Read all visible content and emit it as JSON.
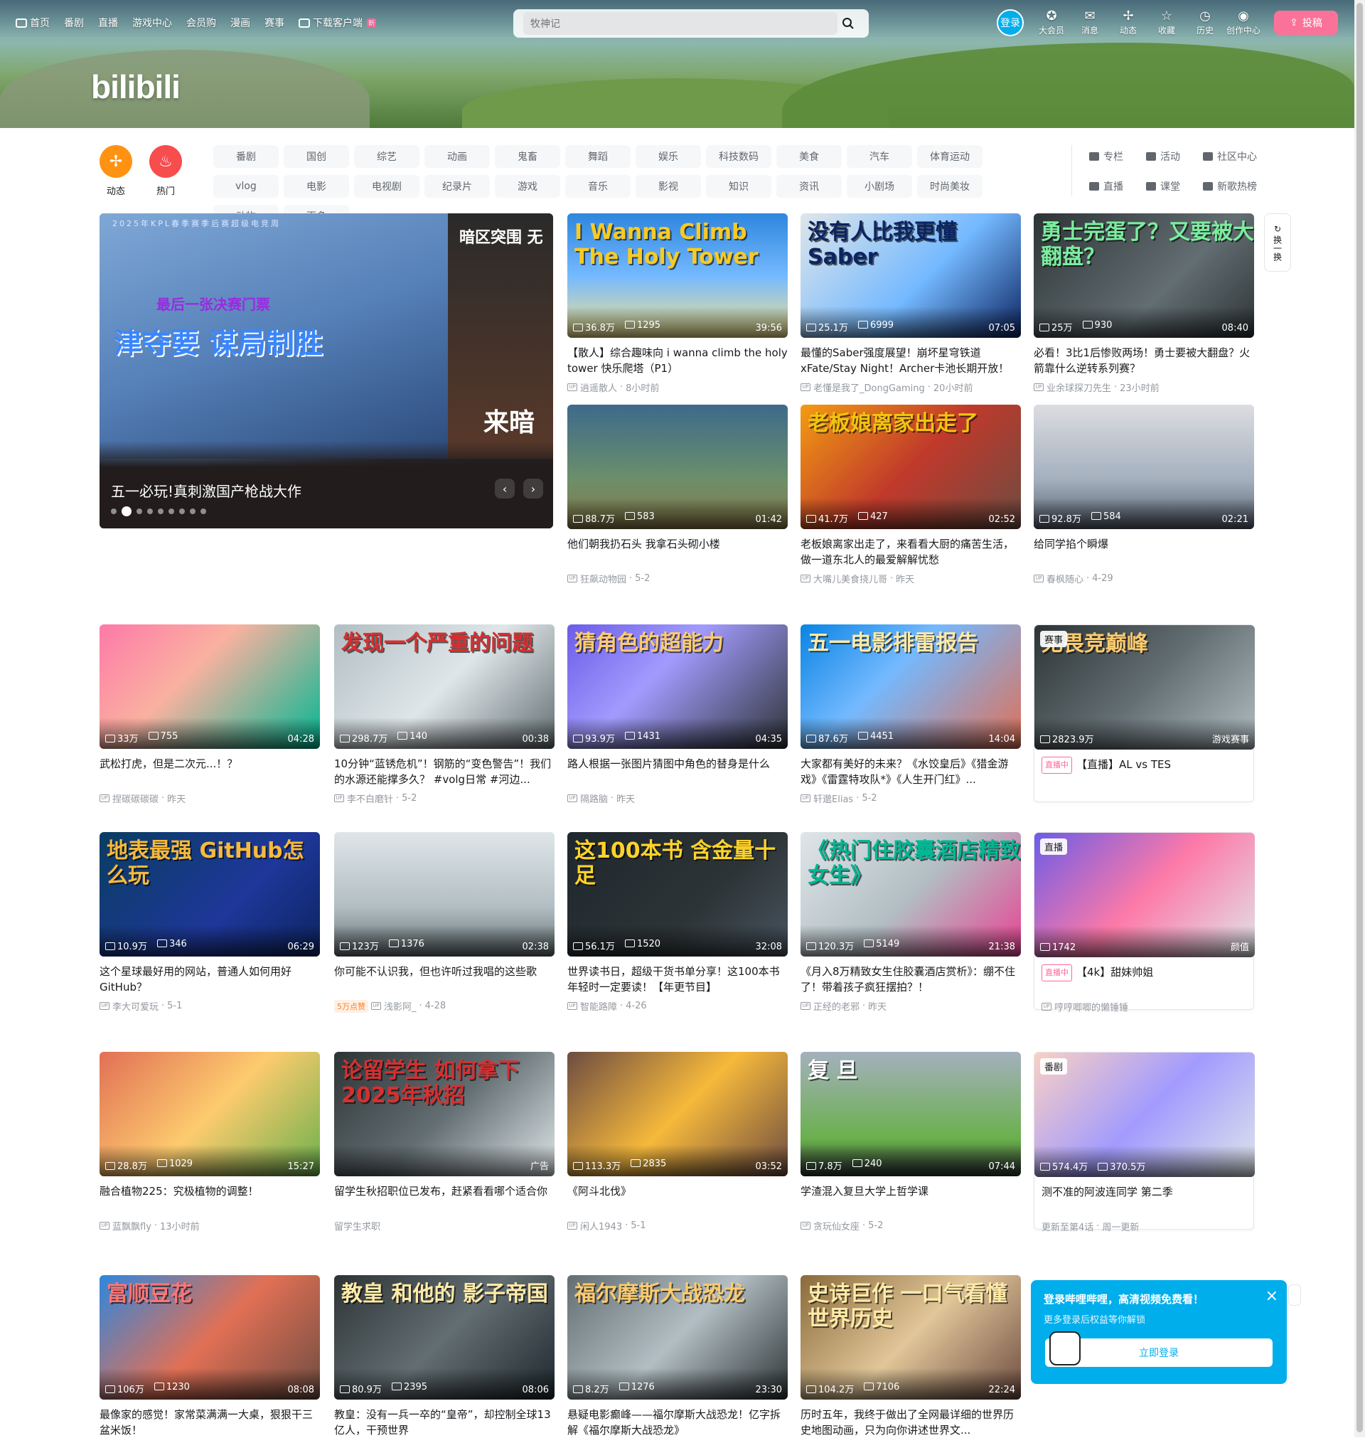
{
  "header": {
    "nav": [
      {
        "label": "首页"
      },
      {
        "label": "番剧"
      },
      {
        "label": "直播"
      },
      {
        "label": "游戏中心"
      },
      {
        "label": "会员购"
      },
      {
        "label": "漫画"
      },
      {
        "label": "赛事"
      },
      {
        "label": "下载客户端",
        "new": "新"
      }
    ],
    "search_placeholder": "牧神记",
    "login_label": "登录",
    "right_icons": [
      {
        "label": "大会员",
        "icon": "vip-icon"
      },
      {
        "label": "消息",
        "icon": "message-icon"
      },
      {
        "label": "动态",
        "icon": "dynamic-icon"
      },
      {
        "label": "收藏",
        "icon": "favorite-icon"
      },
      {
        "label": "历史",
        "icon": "history-icon"
      },
      {
        "label": "创作中心",
        "icon": "creator-icon"
      }
    ],
    "upload_label": "投稿",
    "logo": "bilibili"
  },
  "channels": {
    "dynamic_label": "动态",
    "hot_label": "热门",
    "items": [
      "番剧",
      "国创",
      "综艺",
      "动画",
      "鬼畜",
      "舞蹈",
      "娱乐",
      "科技数码",
      "美食",
      "汽车",
      "体育运动",
      "vlog",
      "电影",
      "电视剧",
      "纪录片",
      "游戏",
      "音乐",
      "影视",
      "知识",
      "资讯",
      "小剧场",
      "时尚美妆",
      "动物",
      "更多"
    ],
    "extra": [
      "专栏",
      "活动",
      "社区中心",
      "直播",
      "课堂",
      "新歌热榜"
    ]
  },
  "carousel": {
    "top_text": "2025年KPL春季赛季后赛超级电竞周",
    "sub_text": "最后一张决赛门票",
    "big_text": "津夺要 谋局制胜",
    "side_top": "暗区突围 无",
    "side_bottom": "来暗",
    "title": "五一必玩!真刺激国产枪战大作",
    "prev": "‹",
    "next": "›"
  },
  "swap_label": "换一换",
  "cards": [
    {
      "title": "【散人】综合趣味向 i wanna climb the holy tower 快乐爬塔（P1）",
      "views": "36.8万",
      "danmaku": "1295",
      "duration": "39:56",
      "author": "逍遥散人",
      "time": "8小时前",
      "overlay": "I Wanna Climb The Holy Tower",
      "bg": "linear-gradient(180deg,#2e86de,#74b9ff 50%,#f6e58d)",
      "ovc": "#f9ca24"
    },
    {
      "title": "最懂的Saber强度展望！崩坏星穹铁道xFate/Stay Night！Archer卡池长期开放！剖...",
      "views": "25.1万",
      "danmaku": "6999",
      "duration": "07:05",
      "author": "老懂是我了_DongGaming",
      "time": "20小时前",
      "overlay": "没有人比我更懂Saber",
      "bg": "linear-gradient(135deg,#dfe6e9,#74b9ff 55%,#0c2461)",
      "ovc": "#0c2461"
    },
    {
      "title": "必看！3比1后惨败两场！勇士要被大翻盘？火箭靠什么逆转系列赛？",
      "views": "25万",
      "danmaku": "930",
      "duration": "08:40",
      "author": "业余球探刀先生",
      "time": "23小时前",
      "overlay": "勇士完蛋了？又要被大翻盘？",
      "bg": "linear-gradient(135deg,#2d3436,#636e72 60%,#2d3436)",
      "ovc": "#7bed9f"
    },
    {
      "title": "他们朝我扔石头 我拿石头砌小楼",
      "views": "88.7万",
      "danmaku": "583",
      "duration": "01:42",
      "author": "狂飙动物园",
      "time": "5-2",
      "overlay": "",
      "bg": "linear-gradient(180deg,#3d6a8c,#6c8f6a 60%,#8a7a4a)",
      "ovc": "#fff"
    },
    {
      "title": "老板娘离家出走了，来看看大厨的痛苦生活，做一道东北人的最爱解解忧愁",
      "views": "41.7万",
      "danmaku": "427",
      "duration": "02:52",
      "author": "大嘴儿美食挠儿哥",
      "time": "昨天",
      "overlay": "老板娘离家出走了",
      "bg": "linear-gradient(135deg,#f39c12,#c0392b 50%,#6d4c41)",
      "ovc": "#f1c40f"
    },
    {
      "title": "给同学掐个瞬爆",
      "views": "92.8万",
      "danmaku": "584",
      "duration": "02:21",
      "author": "春枫随心",
      "time": "4-29",
      "overlay": "",
      "bg": "linear-gradient(180deg,#dcdde1,#a4b0be 60%,#57606f)",
      "ovc": "#fff"
    },
    {
      "title": "武松打虎，但是二次元...！？",
      "views": "33万",
      "danmaku": "755",
      "duration": "04:28",
      "author": "捏碳碳碳碳",
      "time": "昨天",
      "overlay": "",
      "bg": "linear-gradient(135deg,#fd79a8,#fab1a0 40%,#00b894)",
      "ovc": "#fff"
    },
    {
      "title": "10分钟“蓝锈危机”！钢筋的“变色警告”！我们的水源还能撑多久？ #volg日常 #河边...",
      "views": "298.7万",
      "danmaku": "140",
      "duration": "00:38",
      "author": "李不白磨针",
      "time": "5-2",
      "overlay": "发现一个严重的问题",
      "bg": "linear-gradient(135deg,#b2bec3,#dfe6e9 50%,#636e72)",
      "ovc": "#d63031"
    },
    {
      "title": "路人根据一张图片猜图中角色的替身是什么",
      "views": "93.9万",
      "danmaku": "1431",
      "duration": "04:35",
      "author": "隔路脑",
      "time": "昨天",
      "overlay": "猜角色的超能力",
      "bg": "linear-gradient(135deg,#6c5ce7,#a29bfe 40%,#2d3436)",
      "ovc": "#fdcb6e"
    },
    {
      "title": "大家都有美好的未来？《水饺皇后》《猎金游戏》《雷霆特攻队*》《人生开门红》...",
      "views": "87.6万",
      "danmaku": "4451",
      "duration": "14:04",
      "author": "轩邈Elias",
      "time": "5-2",
      "overlay": "五一电影排雷报告",
      "bg": "linear-gradient(135deg,#0984e3,#74b9ff 40%,#e17055)",
      "ovc": "#ffeaa7"
    },
    {
      "title": "【直播】AL vs TES",
      "views": "2823.9万",
      "danmaku": "",
      "duration": "游戏赛事",
      "author": "",
      "time": "",
      "overlay": "无畏竞巅峰",
      "bg": "linear-gradient(135deg,#2d3436,#636e72 50%,#b2bec3)",
      "ovc": "#fdcb6e",
      "badge": "赛事",
      "live": "直播中"
    },
    {
      "title": "这个星球最好用的网站，普通人如何用好GitHub？",
      "views": "10.9万",
      "danmaku": "346",
      "duration": "06:29",
      "author": "李大可爱玩",
      "time": "5-1",
      "overlay": "地表最强 GitHub怎么玩",
      "bg": "linear-gradient(135deg,#0a3d62,#1e3799 60%,#0c2461)",
      "ovc": "#f6b93b"
    },
    {
      "title": "你可能不认识我，但也许听过我唱的这些歌",
      "views": "123万",
      "danmaku": "1376",
      "duration": "02:38",
      "author": "浅影阿_",
      "time": "4-28",
      "overlay": "",
      "bg": "linear-gradient(180deg,#dfe6e9,#b2bec3 60%,#636e72)",
      "ovc": "#fff",
      "hot": "5万点赞"
    },
    {
      "title": "世界读书日，超级干货书单分享！这100本书年轻时一定要读！【年更节目】",
      "views": "56.1万",
      "danmaku": "1520",
      "duration": "32:08",
      "author": "智能路障",
      "time": "4-26",
      "overlay": "这100本书 含金量十足",
      "bg": "linear-gradient(135deg,#1e272e,#2d3436 60%,#485460)",
      "ovc": "#ffd32a"
    },
    {
      "title": "《月入8万精致女生住胶囊酒店赏析》：绷不住了！带着孩子疯狂摆拍？！",
      "views": "120.3万",
      "danmaku": "5149",
      "duration": "21:38",
      "author": "正经的老邪",
      "time": "昨天",
      "overlay": "《热门住胶囊酒店精致女生》",
      "bg": "linear-gradient(135deg,#dfe6e9,#b2bec3 50%,#e84393)",
      "ovc": "#00b894"
    },
    {
      "title": "【4k】甜妹帅姐",
      "views": "1742",
      "danmaku": "",
      "duration": "颜值",
      "author": "哼哼唧唧的懒锤锤",
      "time": "",
      "overlay": "",
      "bg": "linear-gradient(135deg,#6c5ce7,#fd79a8 50%,#dfe6e9)",
      "ovc": "#fff",
      "badge": "直播",
      "live": "直播中"
    },
    {
      "title": "融合植物225：究极植物的调整！",
      "views": "28.8万",
      "danmaku": "1029",
      "duration": "15:27",
      "author": "蓝飘飘fly",
      "time": "13小时前",
      "overlay": "",
      "bg": "linear-gradient(135deg,#e17055,#fdcb6e 50%,#6ab04c)",
      "ovc": "#fff"
    },
    {
      "title": "留学生秋招职位已发布，赶紧看看哪个适合你",
      "views": "",
      "danmaku": "",
      "duration": "广告",
      "author": "留学生求职",
      "time": "",
      "overlay": "论留学生 如何拿下2025年秋招",
      "bg": "linear-gradient(135deg,#2d3436,#636e72 50%,#dfe6e9)",
      "ovc": "#d63031",
      "ad": true
    },
    {
      "title": "《阿斗北伐》",
      "views": "113.3万",
      "danmaku": "2835",
      "duration": "03:52",
      "author": "闲人1943",
      "time": "5-1",
      "overlay": "",
      "bg": "linear-gradient(135deg,#6d4c41,#f6b93b 50%,#6d4c41)",
      "ovc": "#fff"
    },
    {
      "title": "学渣混入复旦大学上哲学课",
      "views": "7.8万",
      "danmaku": "240",
      "duration": "07:44",
      "author": "贪玩仙女座",
      "time": "5-2",
      "overlay": "复 旦",
      "bg": "linear-gradient(180deg,#a4b0be,#6ab04c 70%,#2d3436)",
      "ovc": "#fff"
    },
    {
      "title": "测不准的阿波连同学 第二季",
      "views": "574.4万",
      "danmaku": "370.5万",
      "duration": "",
      "author": "更新至第4话",
      "time": "周一更新",
      "overlay": "",
      "bg": "linear-gradient(135deg,#fad0c4,#a29bfe 50%,#dfe6e9)",
      "ovc": "#fff",
      "badge": "番剧"
    },
    {
      "title": "最像家的感觉！家常菜满满一大桌，狠狠干三盆米饭！",
      "views": "106万",
      "danmaku": "1230",
      "duration": "08:08",
      "author": "",
      "time": "",
      "overlay": "富顺豆花",
      "bg": "linear-gradient(135deg,#2e86de,#e17055 50%,#6d4c41)",
      "ovc": "#ff7675"
    },
    {
      "title": "教皇：没有一兵一卒的“皇帝”，却控制全球13亿人，干预世界",
      "views": "80.9万",
      "danmaku": "2395",
      "duration": "08:06",
      "author": "",
      "time": "",
      "overlay": "教皇 和他的 影子帝国",
      "bg": "linear-gradient(135deg,#2d3436,#636e72 50%,#1e272e)",
      "ovc": "#ffeaa7"
    },
    {
      "title": "悬疑电影癫峰——福尔摩斯大战恐龙！亿字拆解《福尔摩斯大战恐龙》",
      "views": "8.2万",
      "danmaku": "1276",
      "duration": "23:30",
      "author": "",
      "time": "",
      "overlay": "福尔摩斯大战恐龙",
      "bg": "linear-gradient(135deg,#636e72,#b2bec3 50%,#2d3436)",
      "ovc": "#fdcb6e"
    },
    {
      "title": "历时五年，我终于做出了全网最详细的世界历史地图动画，只为向你讲述世界文...",
      "views": "104.2万",
      "danmaku": "7106",
      "duration": "22:24",
      "author": "",
      "time": "",
      "overlay": "史诗巨作 一口气看懂 世界历史",
      "bg": "linear-gradient(135deg,#8a6a3a,#e1c699 50%,#6d4c41)",
      "ovc": "#ffeaa7"
    }
  ],
  "login_popup": {
    "title": "登录哔哩哔哩，高清视频免费看！",
    "subtitle": "更多登录后权益等你解锁",
    "button": "立即登录",
    "close": "×"
  }
}
